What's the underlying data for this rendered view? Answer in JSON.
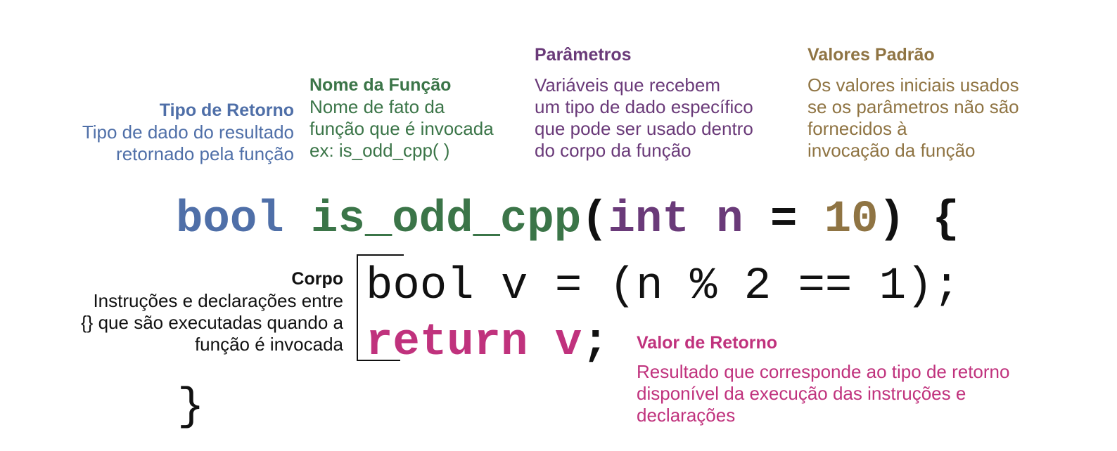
{
  "annotations": {
    "return_type": {
      "heading": "Tipo de Retorno",
      "lines": [
        "Tipo de dado do resultado",
        "retornado pela função"
      ]
    },
    "function_name": {
      "heading": "Nome da Função",
      "lines": [
        "Nome de fato da",
        "função que é invocada",
        "ex: is_odd_cpp( )"
      ]
    },
    "parameters": {
      "heading": "Parâmetros",
      "lines": [
        "Variáveis que recebem",
        "um tipo de dado específico",
        "que pode ser usado dentro",
        "do corpo da função"
      ]
    },
    "default_values": {
      "heading": "Valores Padrão",
      "lines": [
        "Os valores iniciais usados",
        "se os parâmetros não são",
        "fornecidos à",
        "invocação da função"
      ]
    },
    "body": {
      "heading": "Corpo",
      "lines": [
        "Instruções e declarações entre",
        "{} que são executadas quando a",
        "função é invocada"
      ]
    },
    "return_value": {
      "heading": "Valor de Retorno",
      "lines": [
        "Resultado que corresponde ao tipo de retorno",
        "disponível da execução das instruções e",
        "declarações"
      ]
    }
  },
  "code": {
    "signature": {
      "return_type": "bool",
      "function_name": "is_odd_cpp",
      "open_paren": "(",
      "param_type": "int",
      "param_name": "n",
      "equals": "=",
      "default_value": "10",
      "close_paren": ")",
      "open_brace": "{"
    },
    "body_line_1": "bool v = (n % 2 == 1);",
    "body_line_2": {
      "keyword": "return",
      "value": "v",
      "semicolon": ";"
    },
    "closing_brace": "}"
  },
  "colors": {
    "return_type": "#4f6fa8",
    "function_name": "#3b7548",
    "parameters": "#6a3a79",
    "default_values": "#8f7443",
    "return_value": "#c0327d",
    "body": "#111111"
  }
}
